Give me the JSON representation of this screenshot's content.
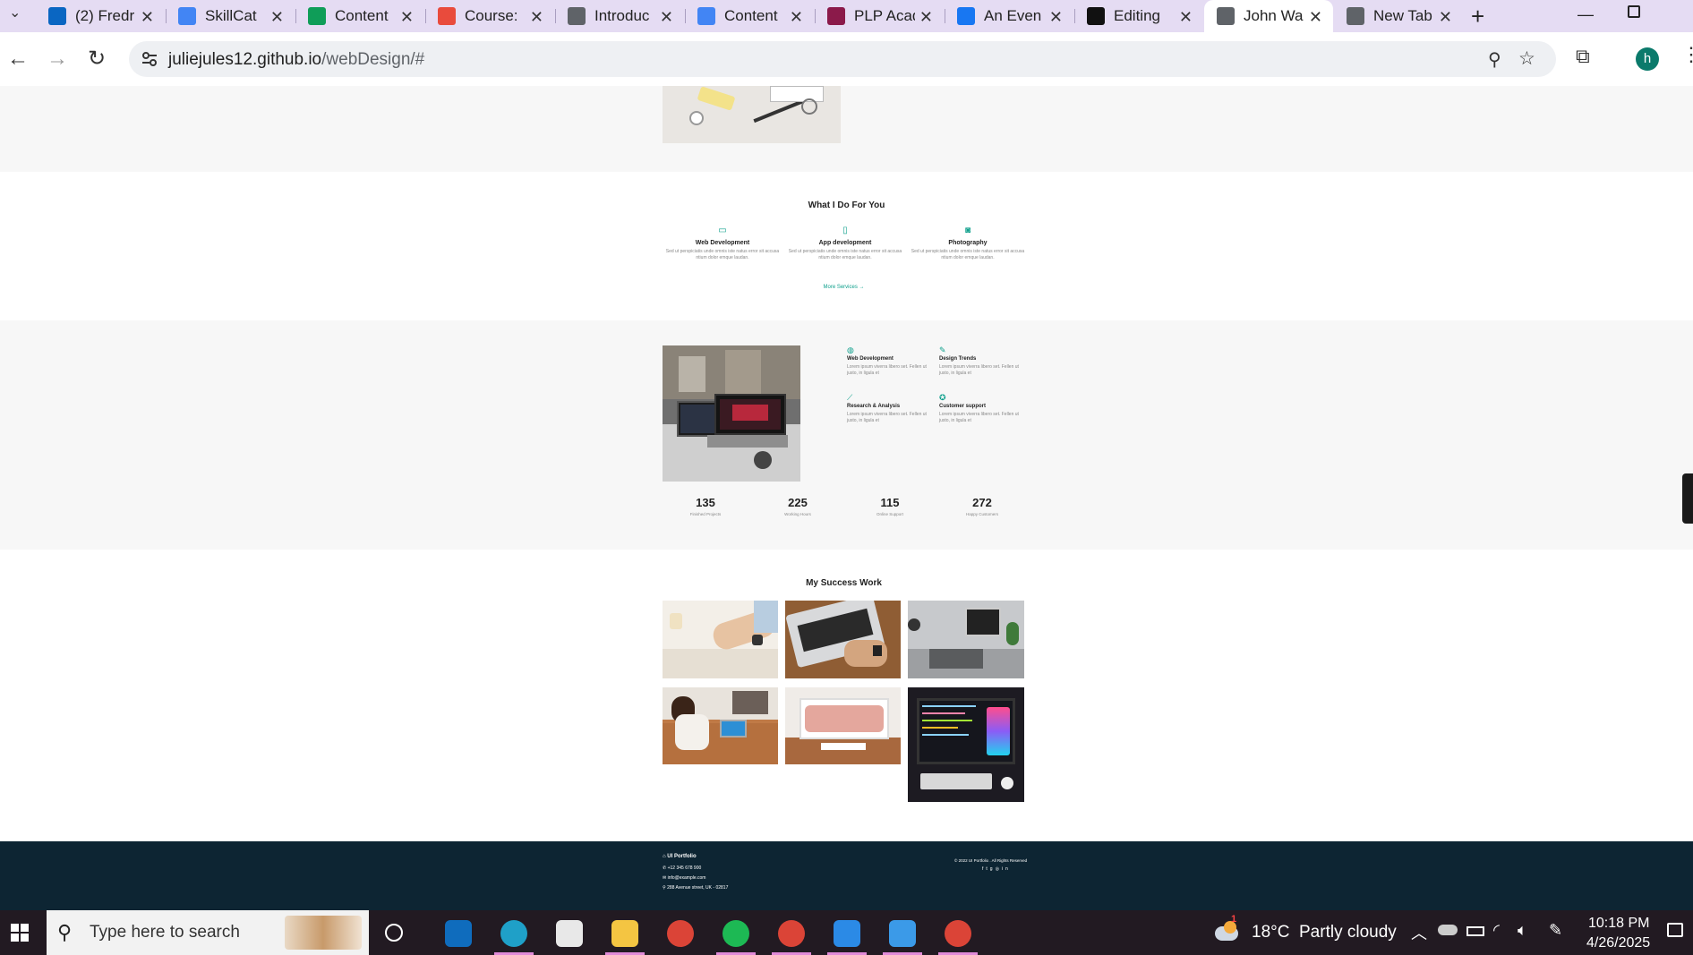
{
  "browser": {
    "tabs": [
      {
        "label": "(2) Fredr",
        "icon": "linkedin-icon",
        "color": "#0a66c2"
      },
      {
        "label": "SkillCat",
        "icon": "docs-icon",
        "color": "#4285f4"
      },
      {
        "label": "Content",
        "icon": "sheets-icon",
        "color": "#0f9d58"
      },
      {
        "label": "Course:",
        "icon": "se-icon",
        "color": "#e94b3c"
      },
      {
        "label": "Introduc",
        "icon": "globe-icon",
        "color": "#5f6368"
      },
      {
        "label": "Content",
        "icon": "docs-icon",
        "color": "#4285f4"
      },
      {
        "label": "PLP Acad",
        "icon": "plp-icon",
        "color": "#8b1a4a"
      },
      {
        "label": "An Even",
        "icon": "facebook-icon",
        "color": "#1877f2"
      },
      {
        "label": "Editing",
        "icon": "github-icon",
        "color": "#111"
      },
      {
        "label": "John Wa",
        "icon": "globe-icon",
        "color": "#5f6368"
      },
      {
        "label": "New Tab",
        "icon": "globe-icon",
        "color": "#5f6368"
      }
    ],
    "url_host": "juliejules12.github.io",
    "url_path": "/webDesign/#",
    "profile_initial": "h"
  },
  "services": {
    "title": "What I Do For You",
    "items": [
      {
        "title": "Web Development",
        "text": "Sed ut perspiciatis unde omnis iste natus error sit accusa ntium dolor emque laudan."
      },
      {
        "title": "App development",
        "text": "Sed ut perspiciatis unde omnis iste natus error sit accusa ntium dolor emque laudan."
      },
      {
        "title": "Photography",
        "text": "Sed ut perspiciatis unde omnis iste natus error sit accusa ntium dolor emque laudan."
      }
    ],
    "more": "More Services →"
  },
  "features": {
    "items": [
      {
        "title": "Web Development",
        "text": "Lorem ipsum viverra libero set. Fellen ut justo, in ligula et"
      },
      {
        "title": "Design Trends",
        "text": "Lorem ipsum viverra libero set. Fellen ut justo, in ligula et"
      },
      {
        "title": "Research & Analysis",
        "text": "Lorem ipsum viverra libero set. Fellen ut justo, in ligula et"
      },
      {
        "title": "Customer support",
        "text": "Lorem ipsum viverra libero set. Fellen ut justo, in ligula et"
      }
    ]
  },
  "stats": [
    {
      "value": "135",
      "label": "Finished Projects"
    },
    {
      "value": "225",
      "label": "Working Hours"
    },
    {
      "value": "115",
      "label": "Online Support"
    },
    {
      "value": "272",
      "label": "Happy Customers"
    }
  ],
  "work": {
    "title": "My Success Work"
  },
  "footer": {
    "brand": "UI Portfolio",
    "phone": "+12 345 678 900",
    "email": "info@example.com",
    "address": "288 Avenue street, UK - 02817",
    "copyright": "© 2022 UI Portfolio . All Rights Reserved"
  },
  "taskbar": {
    "search_placeholder": "Type here to search",
    "weather": "18°C  Partly cloudy",
    "time": "10:18 PM",
    "date": "4/26/2025",
    "weather_badge": "1"
  }
}
